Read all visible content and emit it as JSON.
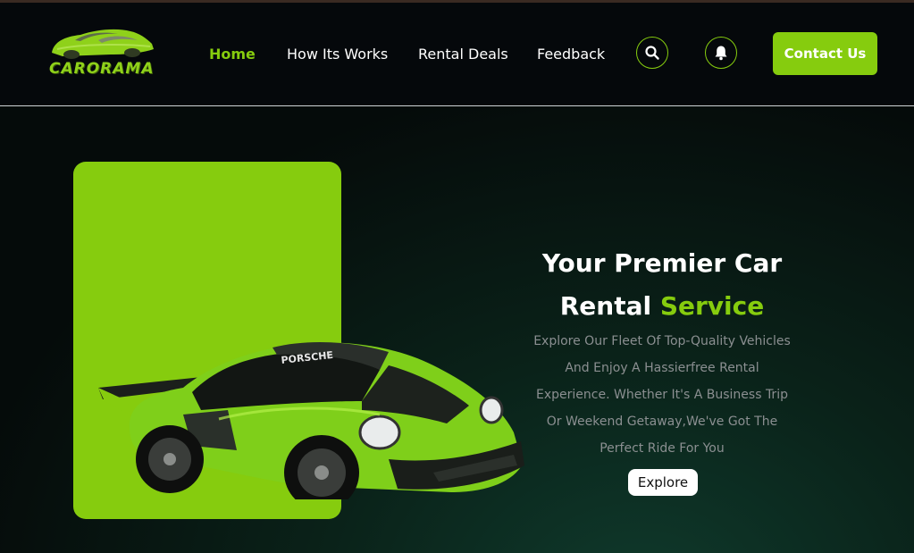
{
  "brand": {
    "name": "CARORAMA"
  },
  "nav": {
    "items": [
      {
        "label": "Home",
        "active": true
      },
      {
        "label": "How Its Works",
        "active": false
      },
      {
        "label": "Rental Deals",
        "active": false
      },
      {
        "label": "Feedback",
        "active": false
      }
    ],
    "search_icon": "search-icon",
    "bell_icon": "bell-icon",
    "contact_label": "Contact Us"
  },
  "hero": {
    "title_line1": "Your Premier Car",
    "title_line2_prefix": "Rental ",
    "title_line2_accent": "Service",
    "description": "Explore Our Fleet Of Top-Quality Vehicles And Enjoy A Hassierfree Rental Experience. Whether It's A Business Trip Or Weekend Getaway,We've Got The Perfect Ride For You",
    "explore_label": "Explore",
    "car_badge": "PORSCHE"
  },
  "colors": {
    "accent": "#86cc0e",
    "background": "#05080b",
    "text": "#ffffff",
    "muted": "#8b8f91"
  }
}
